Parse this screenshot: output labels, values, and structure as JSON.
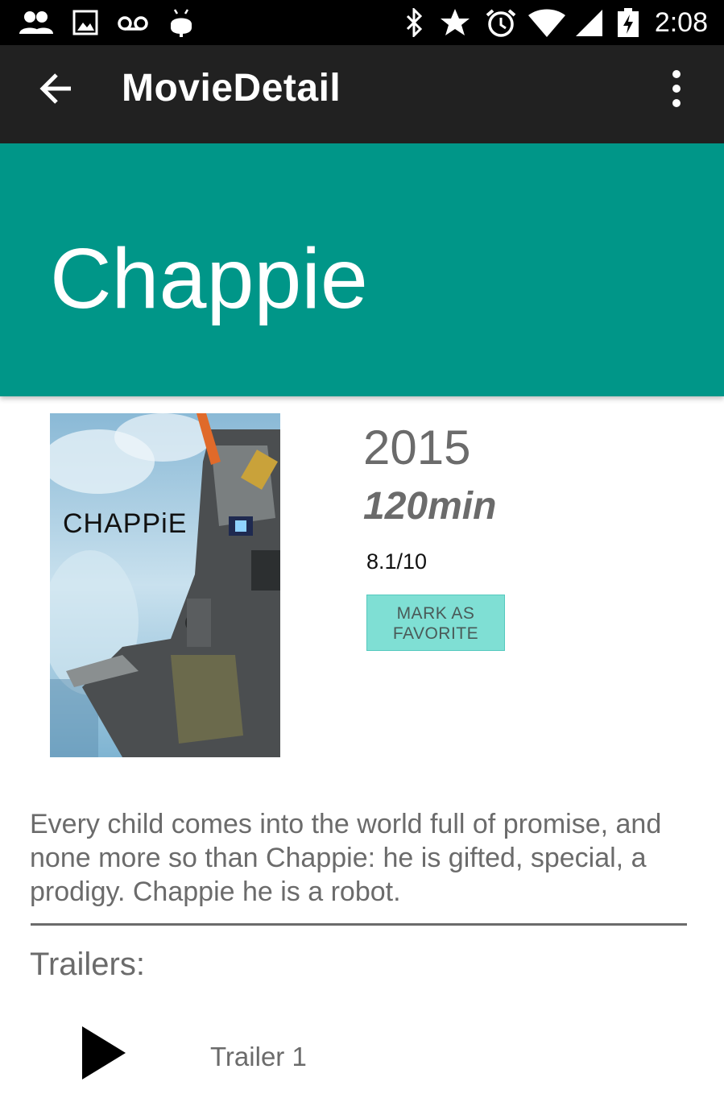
{
  "status_bar": {
    "time": "2:08",
    "icons": [
      "people-icon",
      "image-icon",
      "voicemail-icon",
      "android-icon",
      "bluetooth-icon",
      "star-icon",
      "alarm-icon",
      "wifi-icon",
      "signal-icon",
      "battery-charging-icon"
    ]
  },
  "app_bar": {
    "title": "MovieDetail"
  },
  "movie": {
    "title": "Chappie",
    "poster_label": "CHAPPiE",
    "year": "2015",
    "runtime": "120min",
    "rating": "8.1/10",
    "favorite_button": "MARK AS FAVORITE",
    "overview": "Every child comes into the world full of promise, and none more so than Chappie: he is gifted, special, a prodigy. Chappie he is a robot."
  },
  "trailers": {
    "heading": "Trailers:",
    "items": [
      {
        "label": "Trailer 1"
      }
    ]
  },
  "colors": {
    "status_bar": "#000000",
    "app_bar": "#212121",
    "title_band": "#009688",
    "favorite_button": "#7fdfd4",
    "secondary_text": "#6b6b6b"
  }
}
